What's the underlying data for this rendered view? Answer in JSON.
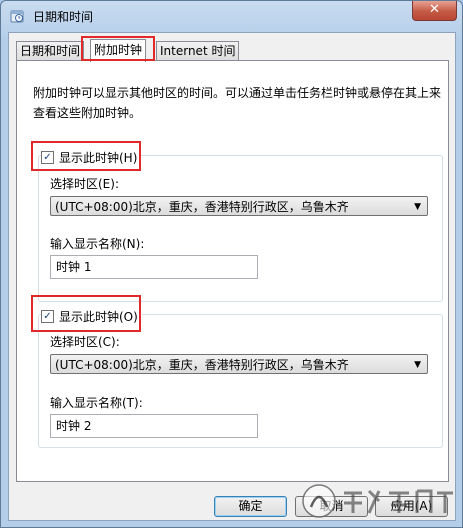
{
  "window": {
    "title": "日期和时间",
    "close_icon": "close-icon"
  },
  "tabs": [
    {
      "label": "日期和时间",
      "active": false
    },
    {
      "label": "附加时钟",
      "active": true
    },
    {
      "label": "Internet 时间",
      "active": false
    }
  ],
  "description": "附加时钟可以显示其他时区的时间。可以通过单击任务栏时钟或悬停在其上来查看这些附加时钟。",
  "clock1": {
    "checkbox_label": "显示此时钟(H)",
    "checked": true,
    "timezone_label": "选择时区(E):",
    "timezone_value": "(UTC+08:00)北京，重庆，香港特别行政区，乌鲁木齐",
    "name_label": "输入显示名称(N):",
    "name_value": "时钟 1"
  },
  "clock2": {
    "checkbox_label": "显示此时钟(O)",
    "checked": true,
    "timezone_label": "选择时区(C):",
    "timezone_value": "(UTC+08:00)北京，重庆，香港特别行政区，乌鲁木齐",
    "name_label": "输入显示名称(T):",
    "name_value": "时钟 2"
  },
  "buttons": {
    "ok": "确定",
    "cancel": "取消",
    "apply": "应用(A)"
  },
  "colors": {
    "highlight": "#e0292b",
    "titlebar": "#b4cde8",
    "close": "#c45a45"
  }
}
